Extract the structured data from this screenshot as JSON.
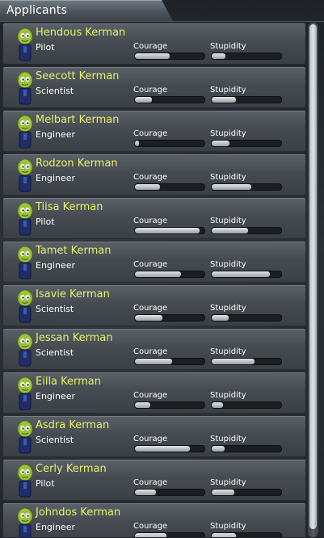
{
  "header": {
    "title": "Applicants"
  },
  "labels": {
    "courage": "Courage",
    "stupidity": "Stupidity"
  },
  "scroll": {
    "visible_fraction": 0.98
  },
  "applicants": [
    {
      "name": "Hendous Kerman",
      "role": "Pilot",
      "courage": 0.5,
      "stupidity": 0.2
    },
    {
      "name": "Seecott Kerman",
      "role": "Scientist",
      "courage": 0.24,
      "stupidity": 0.35
    },
    {
      "name": "Melbart Kerman",
      "role": "Engineer",
      "courage": 0.06,
      "stupidity": 0.25
    },
    {
      "name": "Rodzon Kerman",
      "role": "Engineer",
      "courage": 0.36,
      "stupidity": 0.57
    },
    {
      "name": "Tiisa Kerman",
      "role": "Pilot",
      "courage": 0.93,
      "stupidity": 0.52
    },
    {
      "name": "Tamet Kerman",
      "role": "Engineer",
      "courage": 0.66,
      "stupidity": 0.84
    },
    {
      "name": "Isavie Kerman",
      "role": "Scientist",
      "courage": 0.4,
      "stupidity": 0.24
    },
    {
      "name": "Jessan Kerman",
      "role": "Scientist",
      "courage": 0.54,
      "stupidity": 0.62
    },
    {
      "name": "Eilla Kerman",
      "role": "Engineer",
      "courage": 0.22,
      "stupidity": 0.16
    },
    {
      "name": "Asdra Kerman",
      "role": "Scientist",
      "courage": 0.79,
      "stupidity": 0.19
    },
    {
      "name": "Cerly Kerman",
      "role": "Pilot",
      "courage": 0.3,
      "stupidity": 0.32
    },
    {
      "name": "Johndos Kerman",
      "role": "Engineer",
      "courage": 0.45,
      "stupidity": 0.35
    }
  ],
  "colors": {
    "name": "#e8f06a",
    "role": "#ffffff",
    "bar_fill": "#cfd3d6"
  }
}
